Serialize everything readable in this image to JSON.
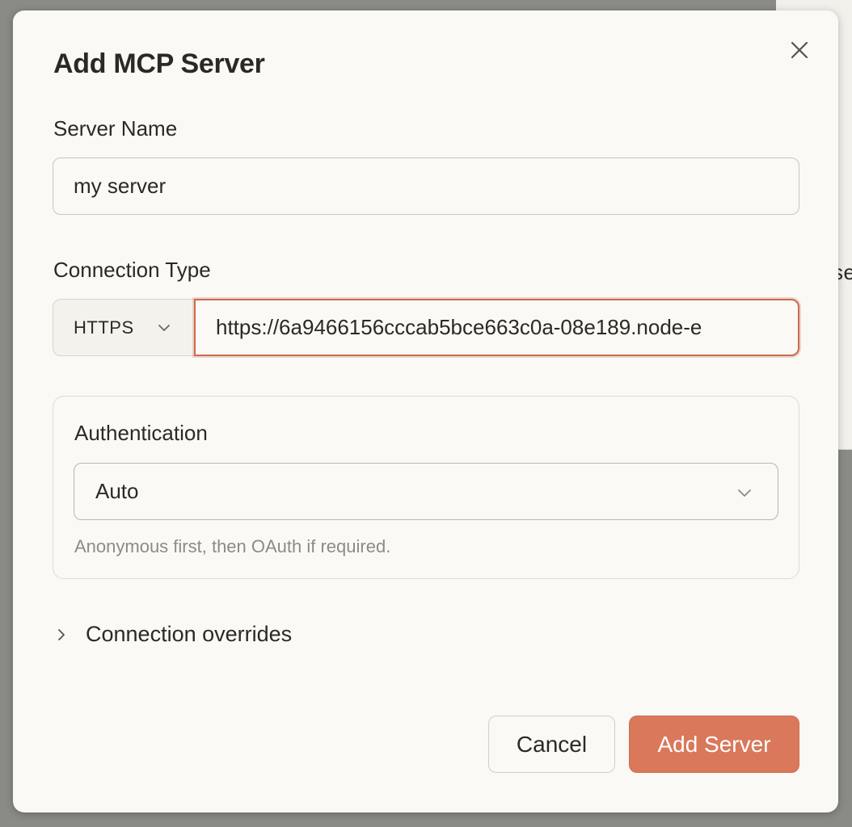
{
  "background": {
    "partial_text": "se"
  },
  "dialog": {
    "title": "Add MCP Server",
    "close_icon": "close-icon",
    "server_name": {
      "label": "Server Name",
      "value": "my server"
    },
    "connection_type": {
      "label": "Connection Type",
      "type_value": "HTTPS",
      "url_value": "https://6a9466156cccab5bce663c0a-08e189.node-e"
    },
    "authentication": {
      "label": "Authentication",
      "value": "Auto",
      "hint": "Anonymous first, then OAuth if required."
    },
    "overrides": {
      "label": "Connection overrides"
    },
    "buttons": {
      "cancel": "Cancel",
      "add": "Add Server"
    }
  },
  "colors": {
    "accent": "#d9785a",
    "focus_border": "#c96b4e",
    "dialog_bg": "#faf9f5",
    "text": "#2b2a22",
    "muted_text": "#8e8b83"
  }
}
